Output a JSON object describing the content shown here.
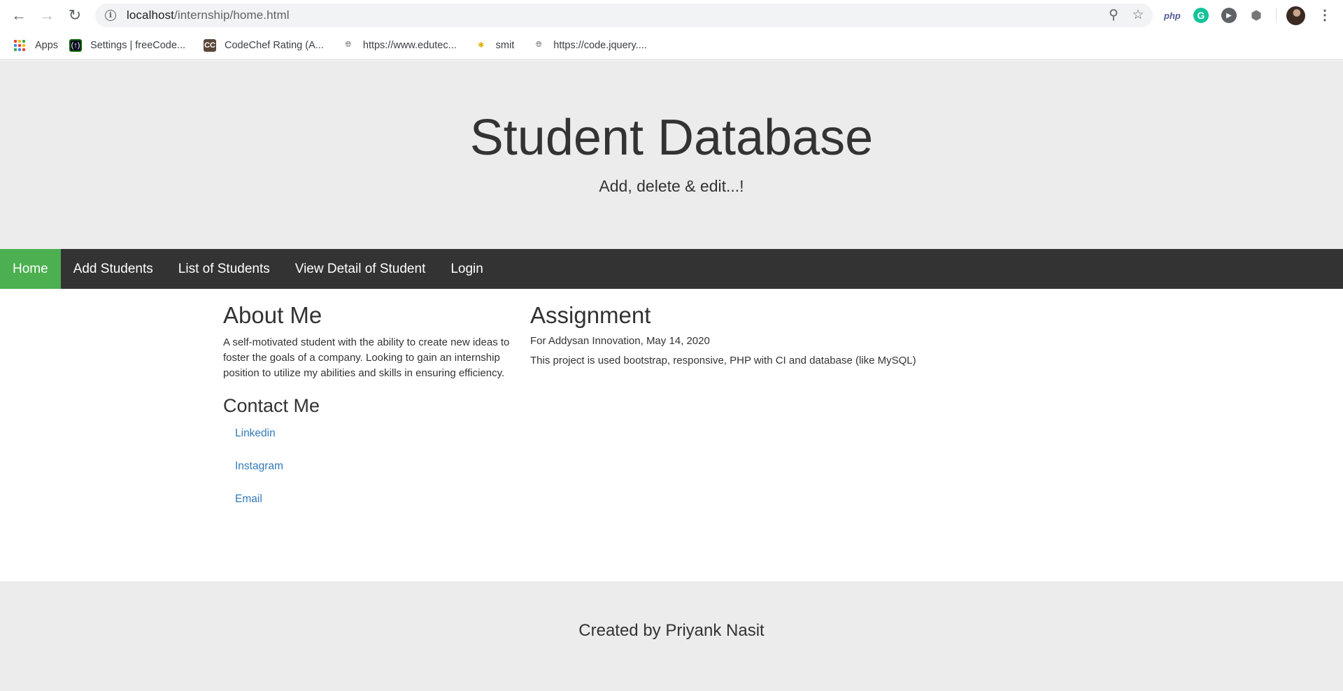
{
  "browser": {
    "url_host": "localhost",
    "url_path": "/internship/home.html",
    "extensions": {
      "php_label": "php",
      "grammarly_label": "G"
    },
    "icons": [
      "back-arrow-icon",
      "forward-arrow-icon",
      "reload-icon",
      "info-icon",
      "zoom-out-icon",
      "star-icon",
      "profile-avatar",
      "kebab-menu-icon"
    ],
    "bookmarks": [
      {
        "label": "Apps",
        "icon": "apps-grid-icon"
      },
      {
        "label": "Settings | freeCode...",
        "icon": "freecodecamp-icon"
      },
      {
        "label": "CodeChef Rating (A...",
        "icon": "codechef-icon"
      },
      {
        "label": "https://www.edutec...",
        "icon": "globe-icon"
      },
      {
        "label": "smit",
        "icon": "smit-icon"
      },
      {
        "label": "https://code.jquery....",
        "icon": "globe-icon"
      }
    ]
  },
  "header": {
    "title": "Student Database",
    "subtitle": "Add, delete & edit...!"
  },
  "nav": {
    "items": [
      {
        "label": "Home",
        "active": true
      },
      {
        "label": "Add Students",
        "active": false
      },
      {
        "label": "List of Students",
        "active": false
      },
      {
        "label": "View Detail of Student",
        "active": false
      },
      {
        "label": "Login",
        "active": false
      }
    ],
    "active_color": "#4caf50",
    "bar_color": "#333333"
  },
  "about": {
    "heading": "About Me",
    "text": "A self-motivated student with the ability to create new ideas to foster the goals of a company. Looking to gain an internship position to utilize my abilities and skills in ensuring efficiency."
  },
  "contact": {
    "heading": "Contact Me",
    "links": [
      "Linkedin",
      "Instagram",
      "Email"
    ],
    "link_color": "#337ab7"
  },
  "assignment": {
    "heading": "Assignment",
    "line1": "For Addysan Innovation, May 14, 2020",
    "line2": "This project is used bootstrap, responsive, PHP with CI and database (like MySQL)"
  },
  "footer": {
    "text": "Created by Priyank Nasit"
  }
}
